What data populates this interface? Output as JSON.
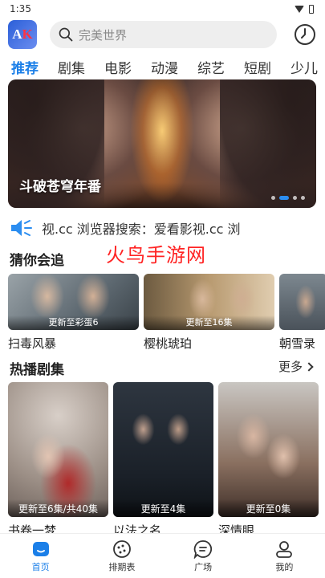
{
  "status": {
    "time": "1:35"
  },
  "header": {
    "logo_text": "AK",
    "search_placeholder": "完美世界"
  },
  "tabs": [
    "推荐",
    "剧集",
    "电影",
    "动漫",
    "综艺",
    "短剧",
    "少儿"
  ],
  "banner": {
    "title": "斗破苍穹年番"
  },
  "notice": {
    "text": "视.cc     浏览器搜索：爱看影视.cc     浏"
  },
  "watermark": "火鸟手游网",
  "guess_section": {
    "title": "猜你会追",
    "items": [
      {
        "title": "扫毒风暴",
        "episode": "更新至彩蛋6"
      },
      {
        "title": "樱桃琥珀",
        "episode": "更新至16集"
      },
      {
        "title": "朝雪录",
        "episode": ""
      }
    ]
  },
  "hot_section": {
    "title": "热播剧集",
    "more_label": "更多",
    "items": [
      {
        "title": "书卷一梦",
        "episode": "更新至6集/共40集"
      },
      {
        "title": "以法之名",
        "episode": "更新至4集"
      },
      {
        "title": "深情眼",
        "episode": "更新至0集"
      }
    ]
  },
  "bottom_nav": [
    {
      "label": "首页",
      "icon": "home-icon",
      "active": true
    },
    {
      "label": "排期表",
      "icon": "schedule-icon",
      "active": false
    },
    {
      "label": "广场",
      "icon": "chat-icon",
      "active": false
    },
    {
      "label": "我的",
      "icon": "profile-icon",
      "active": false
    }
  ],
  "colors": {
    "accent": "#1b7fe8",
    "watermark": "#ff2424"
  }
}
